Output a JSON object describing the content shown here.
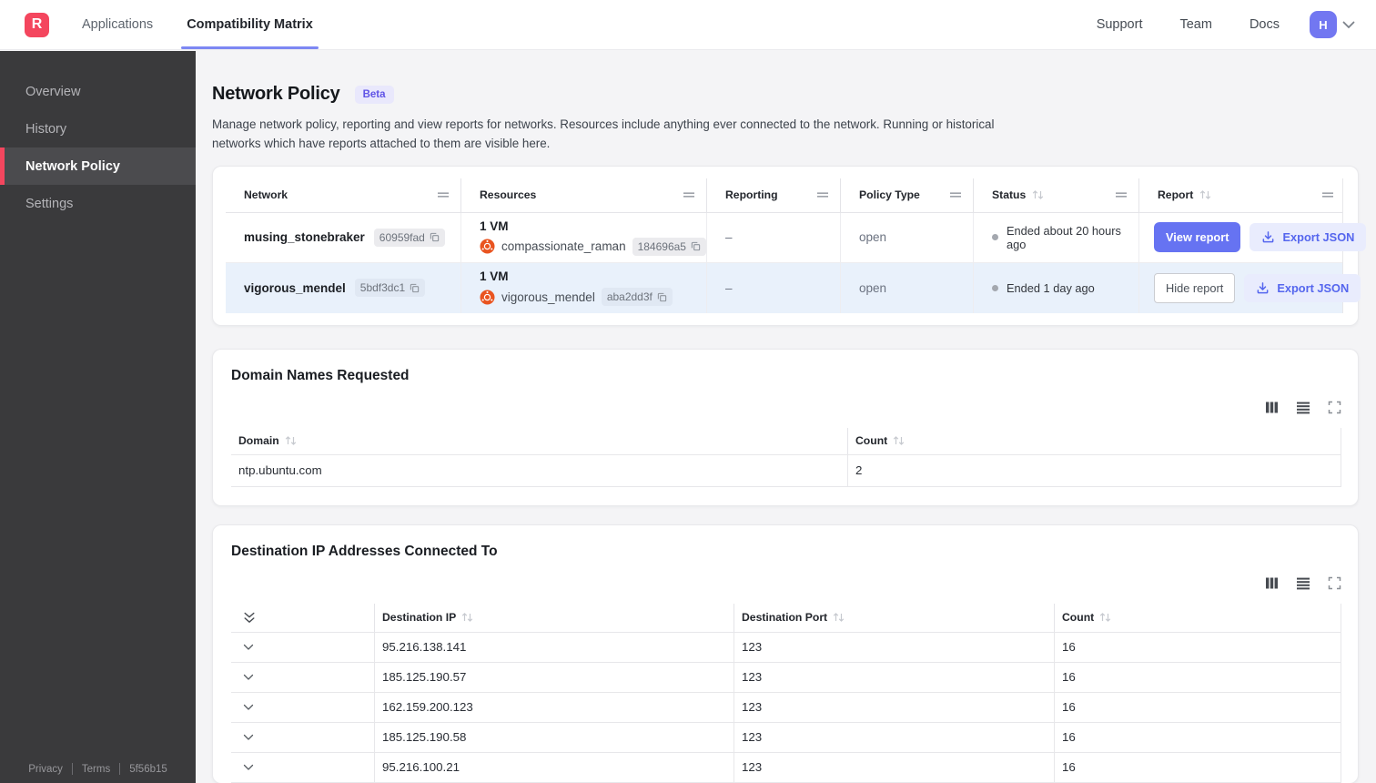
{
  "navbar": {
    "logo_letter": "R",
    "tab_applications": "Applications",
    "tab_compatibility": "Compatibility Matrix",
    "link_support": "Support",
    "link_team": "Team",
    "link_docs": "Docs",
    "avatar_letter": "H"
  },
  "sidebar": {
    "items": [
      {
        "label": "Overview",
        "active": false
      },
      {
        "label": "History",
        "active": false
      },
      {
        "label": "Network Policy",
        "active": true
      },
      {
        "label": "Settings",
        "active": false
      }
    ],
    "footer_privacy": "Privacy",
    "footer_terms": "Terms",
    "footer_version": "5f56b15"
  },
  "page": {
    "title": "Network Policy",
    "beta_badge": "Beta",
    "description": "Manage network policy, reporting and view reports for networks. Resources include anything ever connected to the network. Running or historical networks which have reports attached to them are visible here."
  },
  "networks_table": {
    "headers": {
      "network": "Network",
      "resources": "Resources",
      "reporting": "Reporting",
      "policy_type": "Policy Type",
      "status": "Status",
      "report": "Report"
    },
    "rows": [
      {
        "name": "musing_stonebraker",
        "id_badge": "60959fad",
        "vm_count": "1 VM",
        "resource_name": "compassionate_raman",
        "resource_id_badge": "184696a5",
        "reporting": "–",
        "policy_type": "open",
        "status": "Ended about 20 hours ago",
        "report_action": "View report",
        "export_action": "Export JSON",
        "selected": false
      },
      {
        "name": "vigorous_mendel",
        "id_badge": "5bdf3dc1",
        "vm_count": "1 VM",
        "resource_name": "vigorous_mendel",
        "resource_id_badge": "aba2dd3f",
        "reporting": "–",
        "policy_type": "open",
        "status": "Ended 1 day ago",
        "report_action": "Hide report",
        "export_action": "Export JSON",
        "selected": true
      }
    ]
  },
  "domains_card": {
    "title": "Domain Names Requested",
    "headers": {
      "domain": "Domain",
      "count": "Count"
    },
    "rows": [
      {
        "domain": "ntp.ubuntu.com",
        "count": "2"
      }
    ]
  },
  "ips_card": {
    "title": "Destination IP Addresses Connected To",
    "headers": {
      "ip": "Destination IP",
      "port": "Destination Port",
      "count": "Count"
    },
    "rows": [
      {
        "ip": "95.216.138.141",
        "port": "123",
        "count": "16"
      },
      {
        "ip": "185.125.190.57",
        "port": "123",
        "count": "16"
      },
      {
        "ip": "162.159.200.123",
        "port": "123",
        "count": "16"
      },
      {
        "ip": "185.125.190.58",
        "port": "123",
        "count": "16"
      },
      {
        "ip": "95.216.100.21",
        "port": "123",
        "count": "16"
      }
    ]
  },
  "colors": {
    "brand_red": "#f4465e",
    "accent_indigo": "#6673f2",
    "accent_indigo_light": "#e9ecfd",
    "tab_underline": "#7d87f3",
    "selected_row": "#e9f1fb",
    "sidebar_dark": "#3a3a3c",
    "ubuntu_orange": "#e95420"
  }
}
